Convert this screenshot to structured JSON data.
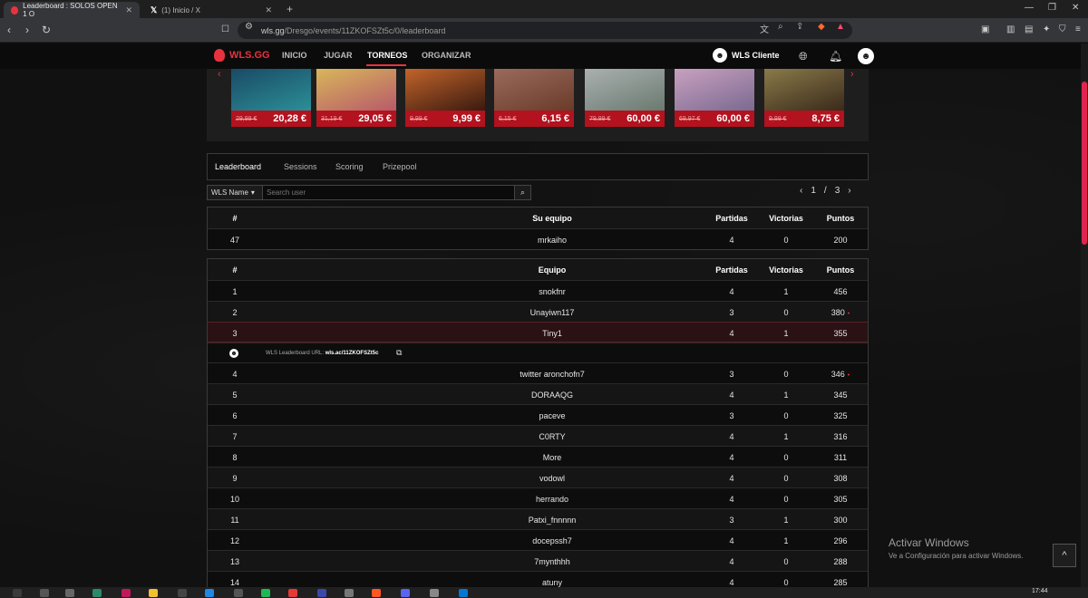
{
  "browser": {
    "tabs": [
      {
        "title": "Leaderboard : SOLOS OPEN 1 O",
        "active": true
      },
      {
        "title": "(1) Inicio / X",
        "active": false
      }
    ],
    "new_tab": "+",
    "url_host": "wls.gg",
    "url_path": "/Dresgo/events/11ZKOFSZt5c/0/leaderboard"
  },
  "site": {
    "logo": "WLS.GG",
    "nav": [
      "INICIO",
      "JUGAR",
      "TORNEOS",
      "ORGANIZAR"
    ],
    "active_nav": "TORNEOS",
    "client_label": "WLS Cliente"
  },
  "shop": {
    "games": [
      {
        "old": "29,99 €",
        "new": "20,28 €",
        "color": "#2b6f86"
      },
      {
        "old": "31,19 €",
        "new": "29,05 €",
        "color": "#c8a04a"
      },
      {
        "old": "9,99 €",
        "new": "9,99 €",
        "color": "#a24a22"
      },
      {
        "old": "6,15 €",
        "new": "6,15 €",
        "color": "#8a5a4a"
      },
      {
        "old": "79,99 €",
        "new": "60,00 €",
        "color": "#7d8f86"
      },
      {
        "old": "69,97 €",
        "new": "60,00 €",
        "color": "#8a7aa0"
      },
      {
        "old": "9,99 €",
        "new": "8,75 €",
        "color": "#6b5a3a"
      }
    ]
  },
  "subtabs": [
    "Leaderboard",
    "Sessions",
    "Scoring",
    "Prizepool"
  ],
  "filter": {
    "select_label": "WLS Name",
    "search_placeholder": "Search user"
  },
  "pager": {
    "current": "1",
    "sep": "/",
    "total": "3"
  },
  "my_team": {
    "headers": {
      "rank": "#",
      "team": "Su equipo",
      "matches": "Partidas",
      "wins": "Victorias",
      "points": "Puntos"
    },
    "row": {
      "rank": "47",
      "team": "mrkaiho",
      "matches": "4",
      "wins": "0",
      "points": "200"
    }
  },
  "leaderboard": {
    "headers": {
      "rank": "#",
      "team": "Equipo",
      "matches": "Partidas",
      "wins": "Victorias",
      "points": "Puntos"
    },
    "url_label": "WLS Leaderboard URL:",
    "url_value": "wls.ac/11ZKOFSZt5c",
    "rows": [
      {
        "rank": "1",
        "team": "snokfnr",
        "matches": "4",
        "wins": "1",
        "points": "456"
      },
      {
        "rank": "2",
        "team": "Unayiwn117",
        "matches": "3",
        "wins": "0",
        "points": "380"
      },
      {
        "rank": "3",
        "team": "Tiny1",
        "matches": "4",
        "wins": "1",
        "points": "355"
      },
      {
        "rank": "4",
        "team": "twitter aronchofn7",
        "matches": "3",
        "wins": "0",
        "points": "346"
      },
      {
        "rank": "5",
        "team": "DORAAQG",
        "matches": "4",
        "wins": "1",
        "points": "345"
      },
      {
        "rank": "6",
        "team": "paceve",
        "matches": "3",
        "wins": "0",
        "points": "325"
      },
      {
        "rank": "7",
        "team": "C0RTY",
        "matches": "4",
        "wins": "1",
        "points": "316"
      },
      {
        "rank": "8",
        "team": "More",
        "matches": "4",
        "wins": "0",
        "points": "311"
      },
      {
        "rank": "9",
        "team": "vodowl",
        "matches": "4",
        "wins": "0",
        "points": "308"
      },
      {
        "rank": "10",
        "team": "herrando",
        "matches": "4",
        "wins": "0",
        "points": "305"
      },
      {
        "rank": "11",
        "team": "Patxi_fnnnnn",
        "matches": "3",
        "wins": "1",
        "points": "300"
      },
      {
        "rank": "12",
        "team": "docepssh7",
        "matches": "4",
        "wins": "1",
        "points": "296"
      },
      {
        "rank": "13",
        "team": "7mynthhh",
        "matches": "4",
        "wins": "0",
        "points": "288"
      },
      {
        "rank": "14",
        "team": "atuny",
        "matches": "4",
        "wins": "0",
        "points": "285"
      }
    ]
  },
  "watermark": {
    "line1": "Activar Windows",
    "line2": "Ve a Configuración para activar Windows."
  },
  "clock": "17:44"
}
